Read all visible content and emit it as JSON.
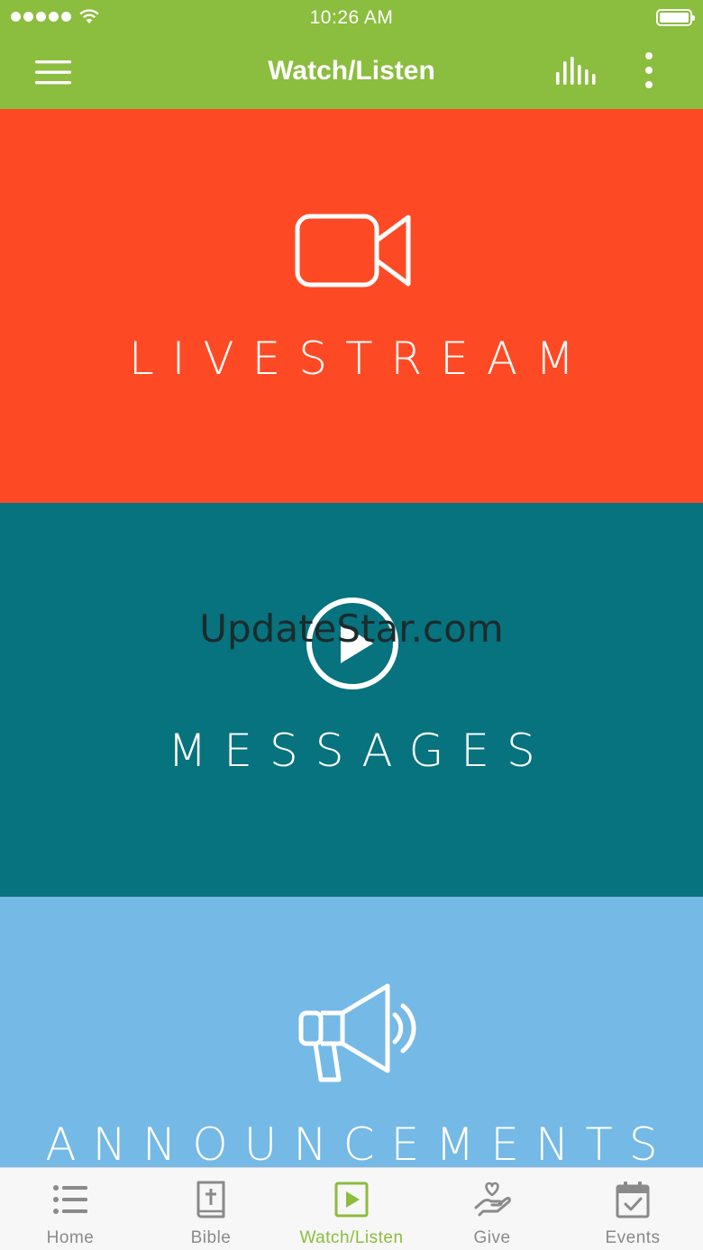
{
  "status_bar": {
    "time": "10:26 AM"
  },
  "header": {
    "title": "Watch/Listen",
    "menu_icon": "hamburger-menu-icon",
    "audio_icon": "audio-bars-icon",
    "more_icon": "more-vertical-icon"
  },
  "tiles": [
    {
      "label": "LIVESTREAM",
      "icon": "video-camera-icon",
      "color": "#fe4a24"
    },
    {
      "label": "MESSAGES",
      "icon": "play-circle-icon",
      "color": "#06737e"
    },
    {
      "label": "ANNOUNCEMENTS",
      "icon": "megaphone-icon",
      "color": "#75b9e6"
    }
  ],
  "watermark": "UpdateStar.com",
  "tabbar": {
    "active_color": "#8bbd3e",
    "inactive_color": "#8a8a8a",
    "items": [
      {
        "label": "Home",
        "icon": "list-icon",
        "active": false
      },
      {
        "label": "Bible",
        "icon": "bible-icon",
        "active": false
      },
      {
        "label": "Watch/Listen",
        "icon": "play-square-icon",
        "active": true
      },
      {
        "label": "Give",
        "icon": "heart-hand-icon",
        "active": false
      },
      {
        "label": "Events",
        "icon": "calendar-check-icon",
        "active": false
      }
    ]
  },
  "theme": {
    "header_color": "#8bbd3e"
  }
}
